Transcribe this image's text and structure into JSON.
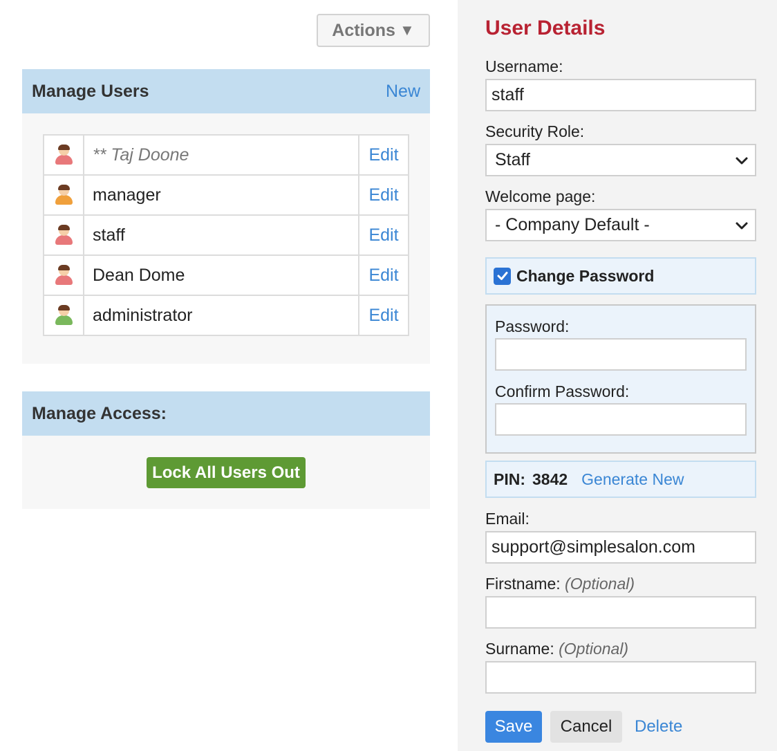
{
  "actions": {
    "label": "Actions",
    "icon": "triangle-down-icon"
  },
  "manage_users": {
    "title": "Manage Users",
    "new_label": "New",
    "users": [
      {
        "name": "** Taj Doone",
        "italic": true,
        "avatar_color": "#e8787a",
        "edit_label": "Edit"
      },
      {
        "name": "manager",
        "italic": false,
        "avatar_color": "#f0a03c",
        "edit_label": "Edit"
      },
      {
        "name": "staff",
        "italic": false,
        "avatar_color": "#e8787a",
        "edit_label": "Edit"
      },
      {
        "name": "Dean Dome",
        "italic": false,
        "avatar_color": "#e8787a",
        "edit_label": "Edit"
      },
      {
        "name": "administrator",
        "italic": false,
        "avatar_color": "#7ab85c",
        "edit_label": "Edit"
      }
    ]
  },
  "manage_access": {
    "title": "Manage Access:",
    "lock_label": "Lock All Users Out"
  },
  "user_details": {
    "title": "User Details",
    "username_label": "Username:",
    "username_value": "staff",
    "security_role_label": "Security Role:",
    "security_role_value": "Staff",
    "welcome_page_label": "Welcome page:",
    "welcome_page_value": "- Company Default -",
    "change_password_label": "Change Password",
    "change_password_checked": true,
    "password_label": "Password:",
    "password_value": "",
    "confirm_password_label": "Confirm Password:",
    "confirm_password_value": "",
    "pin_label": "PIN:",
    "pin_value": "3842",
    "generate_new_label": "Generate New",
    "email_label": "Email:",
    "email_value": "support@simplesalon.com",
    "firstname_label": "Firstname:",
    "firstname_optional": "(Optional)",
    "firstname_value": "",
    "surname_label": "Surname:",
    "surname_optional": "(Optional)",
    "surname_value": "",
    "save_label": "Save",
    "cancel_label": "Cancel",
    "delete_label": "Delete"
  },
  "colors": {
    "accent": "#3a86d4",
    "title_red": "#b82232",
    "header_blue": "#c3ddf0",
    "lock_green": "#5e9a34"
  }
}
